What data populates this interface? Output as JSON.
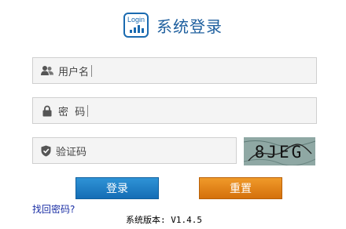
{
  "header": {
    "logo_text": "Login",
    "title": "系统登录"
  },
  "form": {
    "username": {
      "label": "用户名",
      "value": "",
      "icon": "users-icon"
    },
    "password": {
      "label": "密  码",
      "value": "",
      "icon": "lock-icon"
    },
    "captcha": {
      "label": "验证码",
      "value": "",
      "icon": "shield-icon",
      "image_text": "8JEG"
    }
  },
  "buttons": {
    "login": "登录",
    "reset": "重置"
  },
  "forgot_link": "找回密码?",
  "version": "系统版本: V1.4.5",
  "colors": {
    "brand_blue": "#1e5f9e",
    "login_button": "#1f7cc4",
    "reset_button": "#e0800f",
    "field_background": "#f4f4f4",
    "link": "#1b2fa5"
  }
}
